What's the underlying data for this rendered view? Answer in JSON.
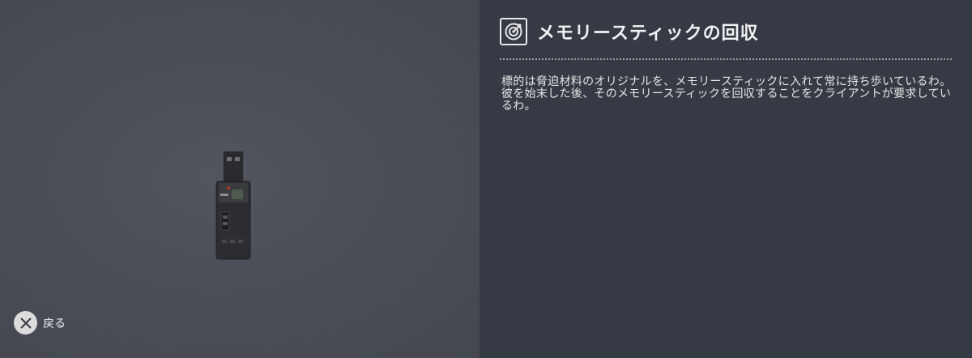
{
  "objective": {
    "title": "メモリースティックの回収",
    "icon": "target-icon",
    "description": "標的は脅迫材料のオリジナルを、メモリースティックに入れて常に持ち歩いているわ。彼を始末した後、そのメモリースティックを回収することをクライアントが要求しているわ。"
  },
  "item_preview": {
    "icon": "usb-memory-stick"
  },
  "footer": {
    "back_icon": "cross-button-icon",
    "back_label": "戻る"
  },
  "colors": {
    "preview_bg": "#4a4d55",
    "info_bg": "#363a44",
    "text": "#f2f2f2"
  }
}
